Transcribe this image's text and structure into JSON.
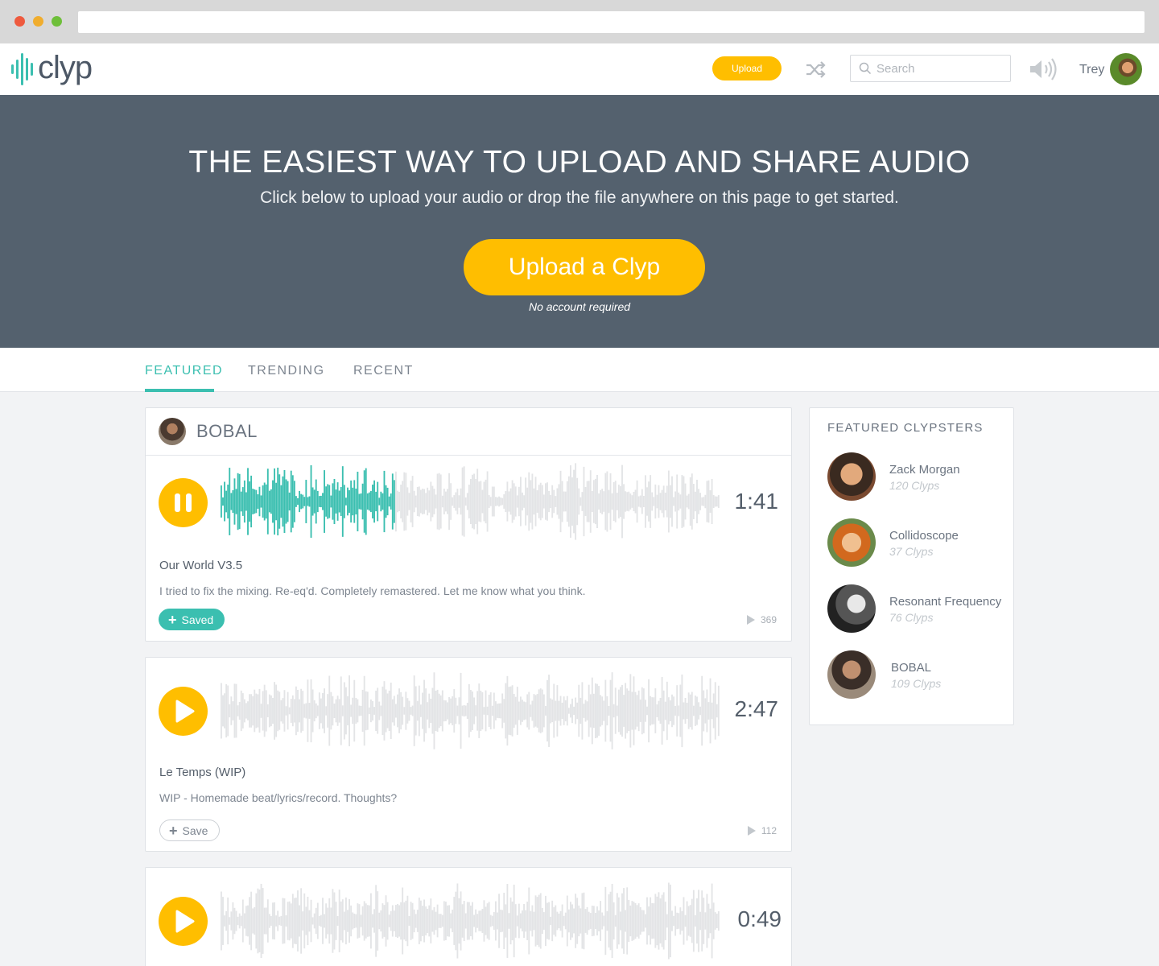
{
  "brand": {
    "name": "clyp",
    "accent": "#3bbfb0",
    "cta": "#ffbe00"
  },
  "header": {
    "upload_label": "Upload",
    "search_placeholder": "Search",
    "user_name": "Trey"
  },
  "hero": {
    "title": "THE EASIEST WAY TO UPLOAD AND SHARE AUDIO",
    "subtitle": "Click below to upload your audio or drop the file anywhere on this page to get started.",
    "cta_label": "Upload a Clyp",
    "note": "No account required"
  },
  "tabs": [
    {
      "label": "FEATURED",
      "active": true
    },
    {
      "label": "TRENDING",
      "active": false
    },
    {
      "label": "RECENT",
      "active": false
    }
  ],
  "clyps": [
    {
      "owner": "BOBAL",
      "playing": true,
      "progress": 0.35,
      "duration": "1:41",
      "title": "Our World V3.5",
      "description": "I tried to fix the mixing. Re-eq'd. Completely remastered. Let me know what you think.",
      "save_label": "Saved",
      "saved": true,
      "plays": "369"
    },
    {
      "playing": false,
      "progress": 0,
      "duration": "2:47",
      "title": "Le Temps (WIP)",
      "description": "WIP - Homemade beat/lyrics/record. Thoughts?",
      "save_label": "Save",
      "saved": false,
      "plays": "112"
    },
    {
      "playing": false,
      "progress": 0,
      "duration": "0:49"
    }
  ],
  "sidebar": {
    "title": "FEATURED CLYPSTERS",
    "clypsters": [
      {
        "name": "Zack Morgan",
        "count": "120 Clyps"
      },
      {
        "name": "Collidoscope",
        "count": "37 Clyps"
      },
      {
        "name": "Resonant Frequency",
        "count": "76 Clyps"
      },
      {
        "name": "BOBAL",
        "count": "109 Clyps"
      }
    ]
  }
}
